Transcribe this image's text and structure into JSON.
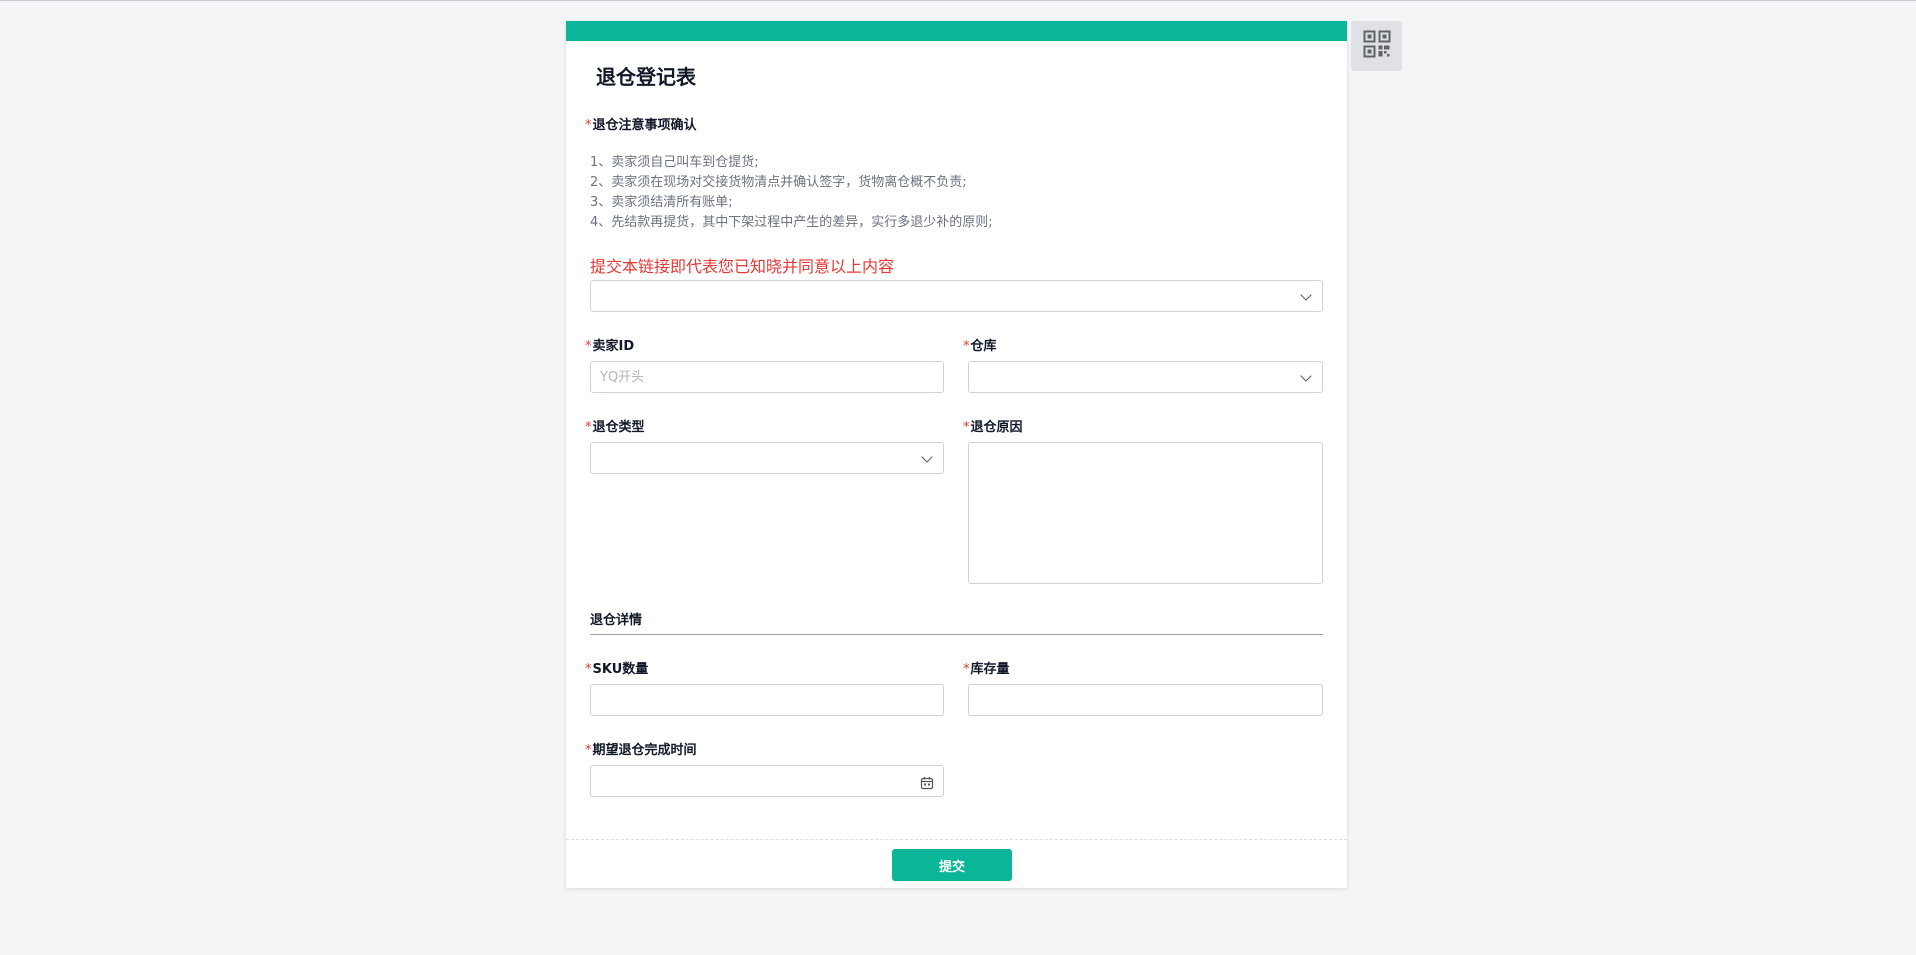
{
  "form": {
    "title": "退仓登记表",
    "notice": {
      "label": "退仓注意事项确认",
      "lines": [
        "1、卖家须自己叫车到仓提货;",
        "2、卖家须在现场对交接货物清点并确认签字，货物离仓概不负责;",
        "3、卖家须结清所有账单;",
        "4、先结款再提货，其中下架过程中产生的差异，实行多退少补的原则;"
      ],
      "agree_text": "提交本链接即代表您已知晓并同意以上内容",
      "agree_select_value": ""
    },
    "seller_id": {
      "label": "卖家ID",
      "placeholder": "YQ开头",
      "value": ""
    },
    "warehouse": {
      "label": "仓库",
      "value": ""
    },
    "return_type": {
      "label": "退仓类型",
      "value": ""
    },
    "return_reason": {
      "label": "退仓原因",
      "value": ""
    },
    "details_section": {
      "title": "退仓详情"
    },
    "sku_count": {
      "label": "SKU数量",
      "value": ""
    },
    "stock_qty": {
      "label": "库存量",
      "value": ""
    },
    "expected_time": {
      "label": "期望退仓完成时间",
      "value": ""
    },
    "required_mark": "*",
    "submit_label": "提交"
  },
  "icons": {
    "qr": "qr-code-icon",
    "calendar": "calendar-icon",
    "dropdown": "chevron-down-icon"
  },
  "colors": {
    "accent": "#0bb597",
    "required": "#e53935",
    "background": "#f4f5f7"
  }
}
